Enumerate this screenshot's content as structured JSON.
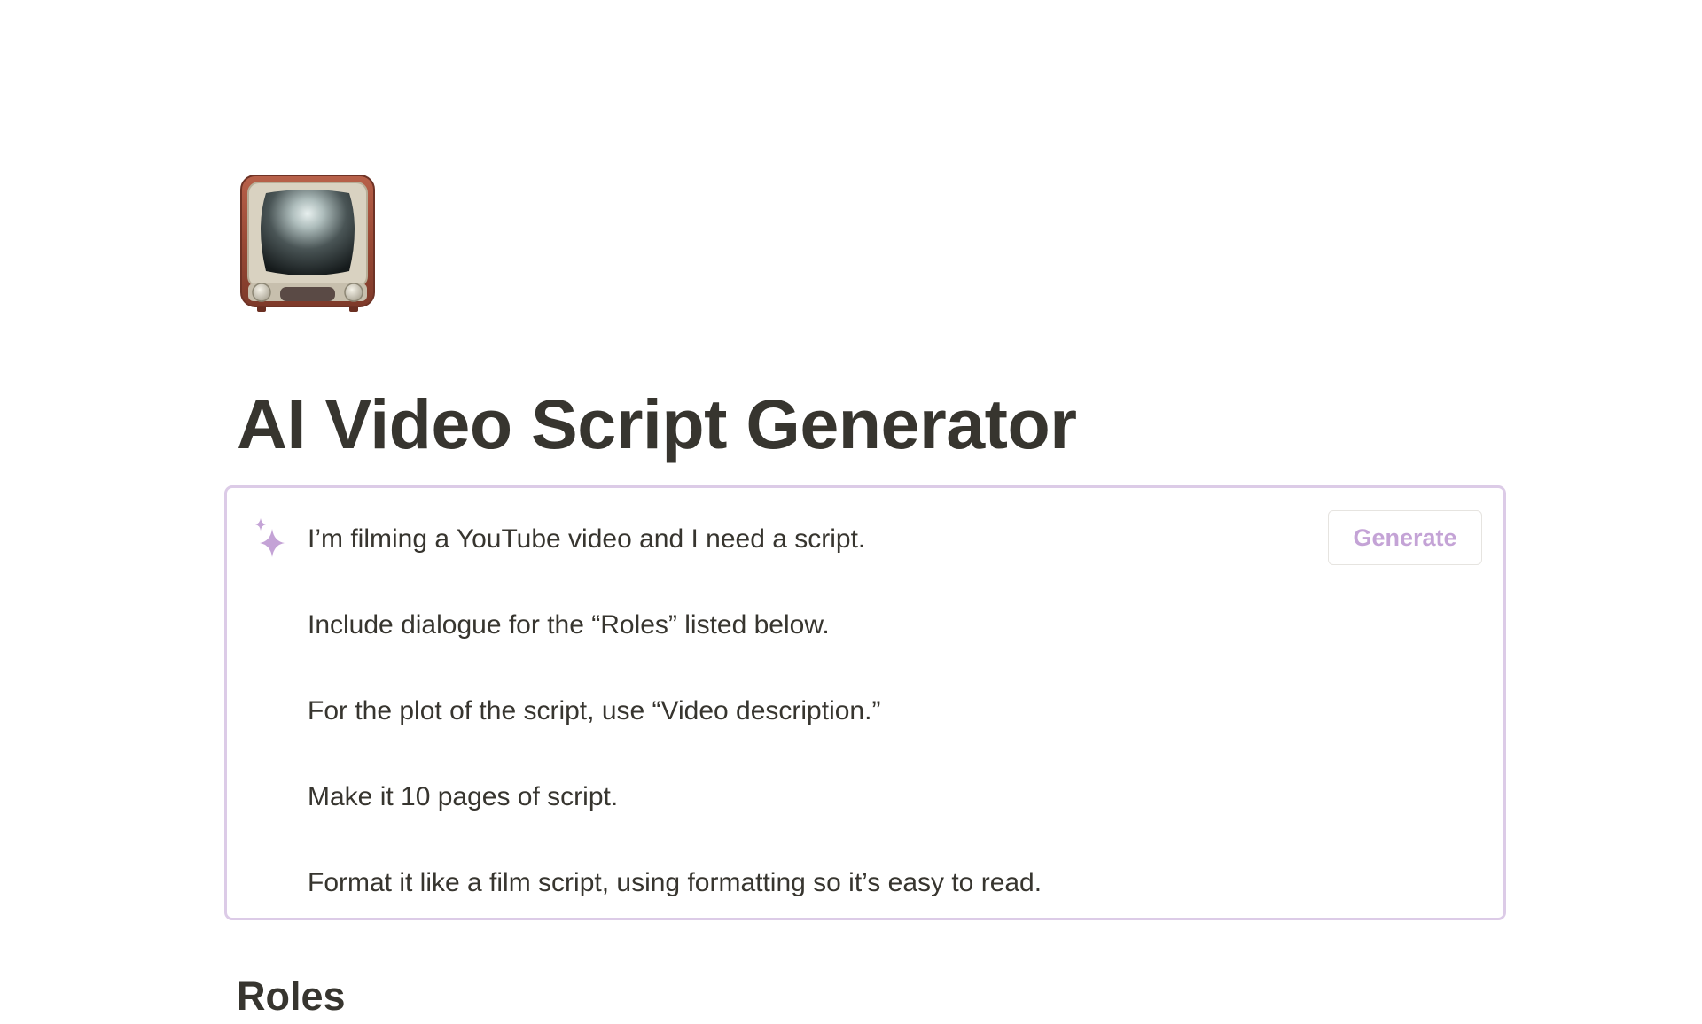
{
  "page": {
    "icon": "television-icon",
    "title": "AI Video Script Generator"
  },
  "ai_block": {
    "icon": "sparkle-icon",
    "accent_color": "#c4a3d6",
    "border_color": "#dccbe7",
    "generate_label": "Generate",
    "prompt_lines": [
      "I’m filming a YouTube video and I need a script.",
      "Include dialogue for the “Roles” listed below.",
      "For the plot of the script, use “Video description.”",
      "Make it 10 pages of script.",
      "Format it like a film script, using formatting so it’s easy to read."
    ]
  },
  "sections": {
    "roles_heading": "Roles"
  }
}
